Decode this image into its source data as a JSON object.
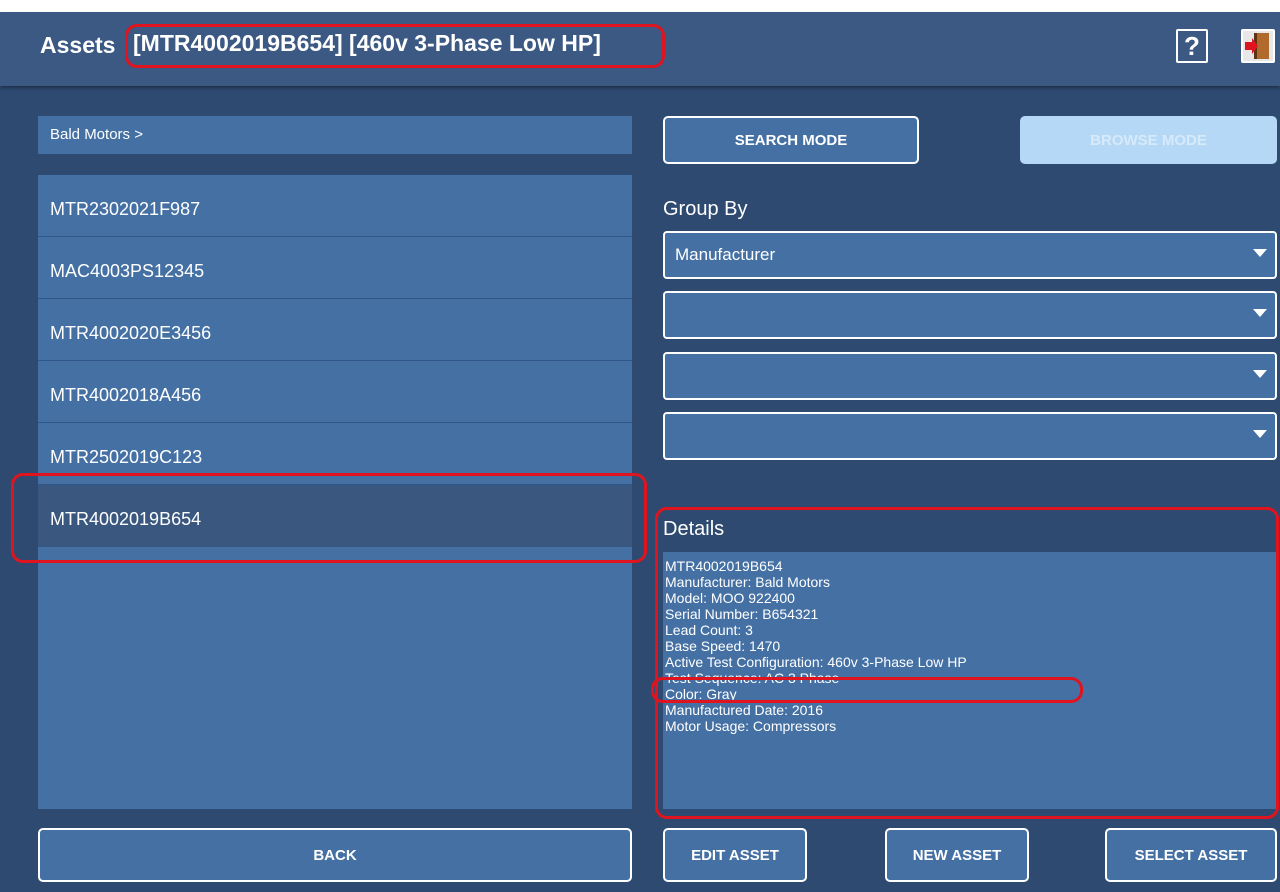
{
  "header": {
    "app_title": "Assets",
    "asset_title": "[MTR4002019B654] [460v 3-Phase Low HP]",
    "help_label": "?"
  },
  "breadcrumb": "Bald Motors >",
  "assets": [
    "MTR2302021F987",
    "MAC4003PS12345",
    "MTR4002020E3456",
    "MTR4002018A456",
    "MTR2502019C123",
    "MTR4002019B654"
  ],
  "selected_asset": "MTR4002019B654",
  "modes": {
    "search_label": "SEARCH MODE",
    "browse_label": "BROWSE MODE"
  },
  "group_by": {
    "label": "Group By",
    "selects": [
      "Manufacturer",
      "",
      "",
      ""
    ]
  },
  "details": {
    "label": "Details",
    "lines": [
      "MTR4002019B654",
      "Manufacturer: Bald Motors",
      "Model: MOO 922400",
      "Serial Number: B654321",
      "Lead Count: 3",
      "Base Speed: 1470",
      "Active Test Configuration: 460v 3-Phase Low HP",
      "Test Sequence: AC 3 Phase",
      "Color: Gray",
      "Manufactured Date: 2016",
      "Motor Usage: Compressors"
    ]
  },
  "footer": {
    "back_label": "BACK",
    "edit_label": "EDIT ASSET",
    "new_label": "NEW ASSET",
    "select_label": "SELECT ASSET"
  },
  "colors": {
    "background": "#2e4a70",
    "panel": "#4470a3",
    "selected": "#39577f",
    "highlight": "#e0141e"
  },
  "icons": {
    "help": "help-icon",
    "exit": "exit-icon",
    "dropdown": "chevron-down-icon"
  }
}
